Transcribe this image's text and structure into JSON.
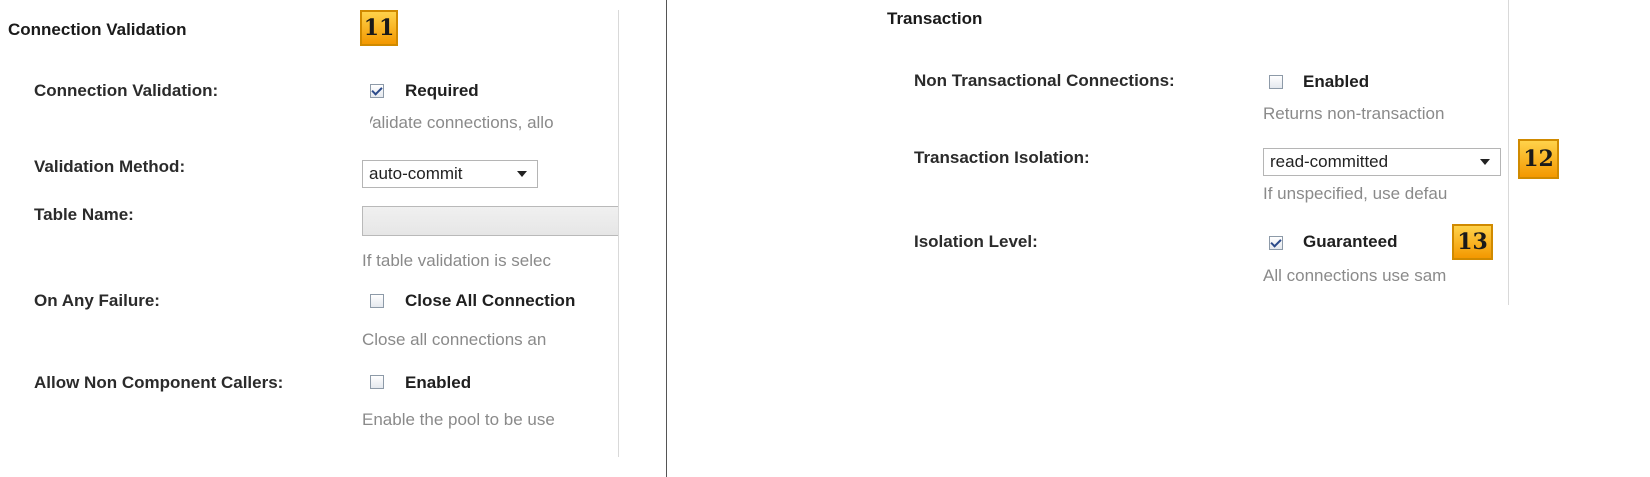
{
  "connection_validation": {
    "section_title": "Connection Validation",
    "badge": "11",
    "connection_validation": {
      "label": "Connection Validation:",
      "checkbox_label": "Required",
      "checked": true,
      "help": "Validate connections, allo"
    },
    "validation_method": {
      "label": "Validation Method:",
      "selected": "auto-commit"
    },
    "table_name": {
      "label": "Table Name:",
      "value": "",
      "help": "If table validation is selec"
    },
    "on_any_failure": {
      "label": "On Any Failure:",
      "checkbox_label": "Close All Connection",
      "checked": false,
      "help": "Close all connections an"
    },
    "allow_non_component_callers": {
      "label": "Allow Non Component Callers:",
      "checkbox_label": "Enabled",
      "checked": false,
      "help": "Enable the pool to be use"
    }
  },
  "transaction": {
    "section_title": "Transaction",
    "non_transactional_connections": {
      "label": "Non Transactional Connections:",
      "checkbox_label": "Enabled",
      "checked": false,
      "help": "Returns non-transaction"
    },
    "transaction_isolation": {
      "label": "Transaction Isolation:",
      "selected": "read-committed",
      "badge": "12",
      "help": "If unspecified, use defau"
    },
    "isolation_level": {
      "label": "Isolation Level:",
      "checkbox_label": "Guaranteed",
      "checked": true,
      "badge": "13",
      "help": "All connections use sam"
    }
  }
}
